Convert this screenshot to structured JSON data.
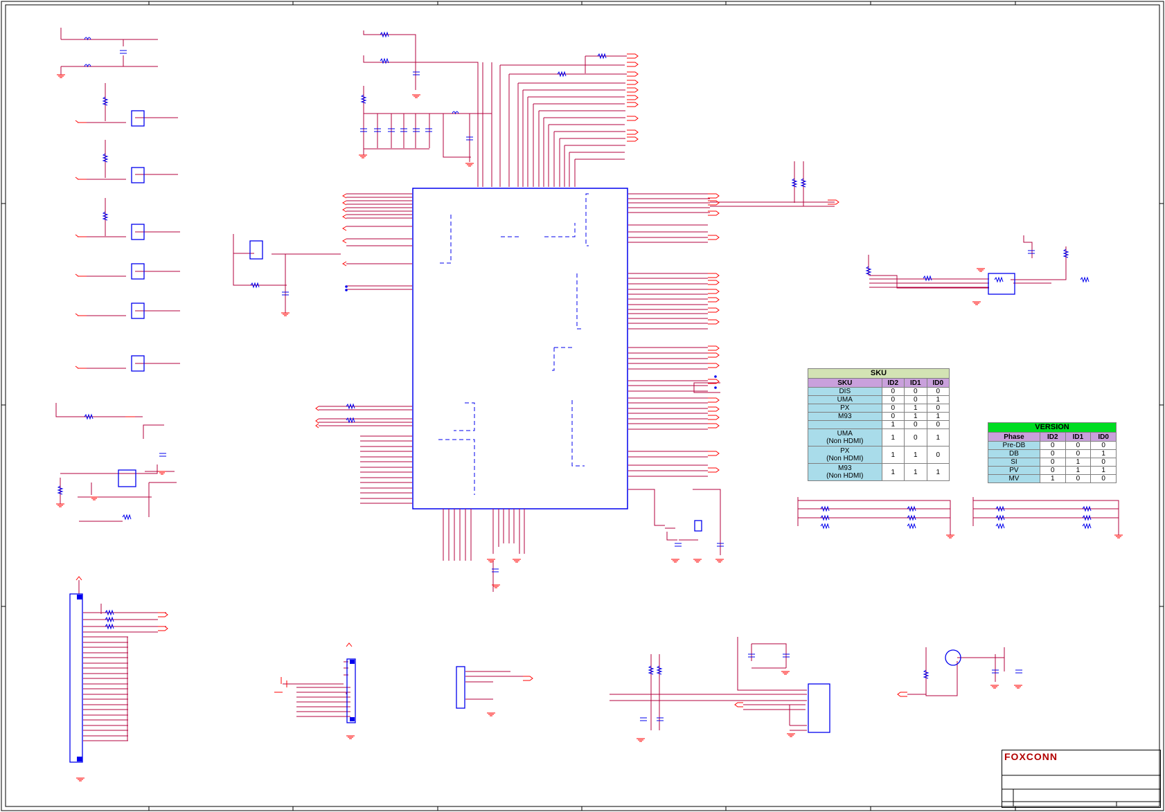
{
  "colors": {
    "wire": "#b3003c",
    "pin": "#ff0000",
    "body": "#0000ee",
    "border": "#000000"
  },
  "sku_table": {
    "title": "SKU",
    "headers": [
      "SKU",
      "ID2",
      "ID1",
      "ID0"
    ],
    "rows": [
      {
        "name": "DIS",
        "id2": "0",
        "id1": "0",
        "id0": "0"
      },
      {
        "name": "UMA",
        "id2": "0",
        "id1": "0",
        "id0": "1"
      },
      {
        "name": "PX",
        "id2": "0",
        "id1": "1",
        "id0": "0"
      },
      {
        "name": "M93",
        "id2": "0",
        "id1": "1",
        "id0": "1"
      },
      {
        "name": "",
        "id2": "1",
        "id1": "0",
        "id0": "0"
      },
      {
        "name": "UMA\n(Non HDMI)",
        "id2": "1",
        "id1": "0",
        "id0": "1"
      },
      {
        "name": "PX\n(Non HDMI)",
        "id2": "1",
        "id1": "1",
        "id0": "0"
      },
      {
        "name": "M93\n(Non HDMI)",
        "id2": "1",
        "id1": "1",
        "id0": "1"
      }
    ]
  },
  "version_table": {
    "title": "VERSION",
    "headers": [
      "Phase",
      "ID2",
      "ID1",
      "ID0"
    ],
    "rows": [
      {
        "name": "Pre-DB",
        "id2": "0",
        "id1": "0",
        "id0": "0"
      },
      {
        "name": "DB",
        "id2": "0",
        "id1": "0",
        "id0": "1"
      },
      {
        "name": "SI",
        "id2": "0",
        "id1": "1",
        "id0": "0"
      },
      {
        "name": "PV",
        "id2": "0",
        "id1": "1",
        "id0": "1"
      },
      {
        "name": "MV",
        "id2": "1",
        "id1": "0",
        "id0": "0"
      }
    ]
  },
  "title_block": {
    "logo_text": "FOXCONN"
  }
}
